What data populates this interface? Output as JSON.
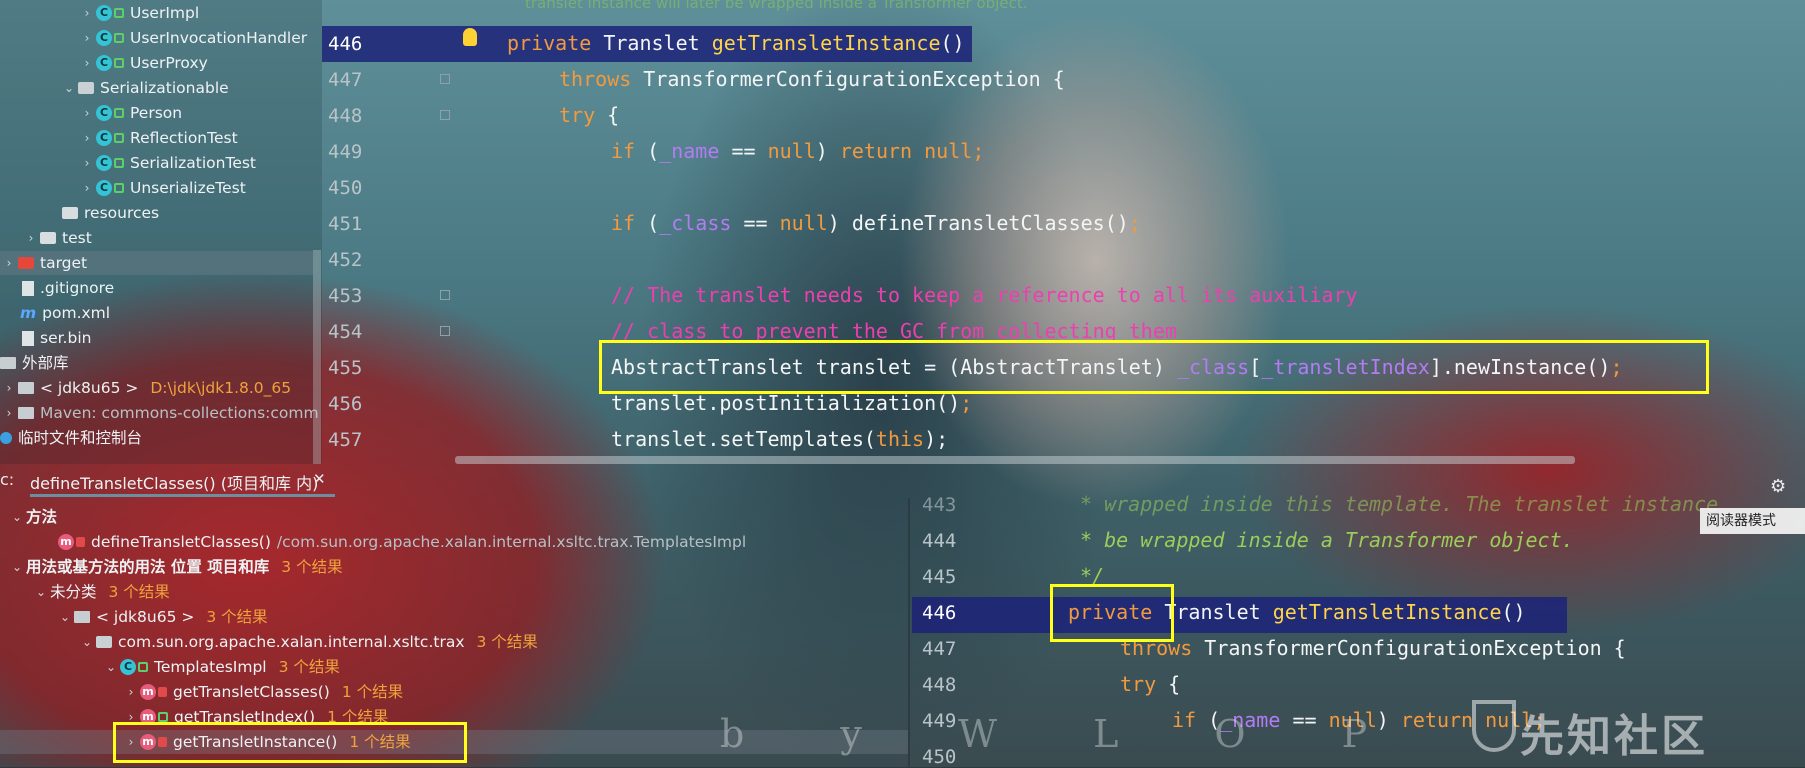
{
  "tree": {
    "items": [
      {
        "label": "UserImpl",
        "icon": "class-icon",
        "indent": 3
      },
      {
        "label": "UserInvocationHandler",
        "icon": "class-icon",
        "indent": 3
      },
      {
        "label": "UserProxy",
        "icon": "class-icon",
        "indent": 3
      },
      {
        "label": "Serializationable",
        "icon": "package-icon",
        "indent": 2
      },
      {
        "label": "Person",
        "icon": "class-icon",
        "indent": 3
      },
      {
        "label": "ReflectionTest",
        "icon": "class-icon",
        "indent": 3
      },
      {
        "label": "SerializationTest",
        "icon": "class-icon",
        "indent": 3
      },
      {
        "label": "UnserializeTest",
        "icon": "class-icon",
        "indent": 3
      },
      {
        "label": "resources",
        "icon": "folder-icon",
        "indent": 1
      },
      {
        "label": "test",
        "icon": "folder-icon",
        "indent": 0
      },
      {
        "label": "target",
        "icon": "folder-red-icon",
        "indent": -1
      },
      {
        "label": ".gitignore",
        "icon": "file-icon",
        "indent": -1
      },
      {
        "label": "pom.xml",
        "icon": "maven-icon",
        "indent": -1
      },
      {
        "label": "ser.bin",
        "icon": "file-icon",
        "indent": -1
      },
      {
        "label": "外部库",
        "icon": "library-icon",
        "indent": -2
      },
      {
        "label": "< jdk8u65 >",
        "extra": "D:\\jdk\\jdk1.8.0_65",
        "icon": "library-icon",
        "indent": -1
      },
      {
        "label": "Maven: commons-collections:comm",
        "icon": "library-icon",
        "indent": -1
      },
      {
        "label": "临时文件和控制台",
        "icon": "console-icon",
        "indent": -2
      }
    ]
  },
  "editor_top": {
    "faded_comment": "translet instance will later be wrapped inside a Transformer object.",
    "line_numbers": [
      "446",
      "447",
      "448",
      "449",
      "450",
      "451",
      "452",
      "453",
      "454",
      "455",
      "456",
      "457"
    ],
    "lines": {
      "l446a": "private",
      "l446b": " Translet ",
      "l446c": "getTransletInstance",
      "l446d": "()",
      "l447a": "throws",
      "l447b": " TransformerConfigurationException {",
      "l448a": "try",
      "l448b": " {",
      "l449a": "if",
      "l449b": " (",
      "l449c": "_name",
      "l449d": " == ",
      "l449e": "null",
      "l449f": ") ",
      "l449g": "return",
      "l449h": " ",
      "l449i": "null",
      "l449j": ";",
      "l451a": "if",
      "l451b": " (",
      "l451c": "_class",
      "l451d": " == ",
      "l451e": "null",
      "l451f": ") defineTransletClasses()",
      "l451g": ";",
      "l453": "// The translet needs to keep a reference to all its auxiliary",
      "l454": "// class to prevent the GC from collecting them",
      "l455a": "AbstractTranslet translet = (AbstractTranslet) ",
      "l455b": "_class",
      "l455c": "[",
      "l455d": "_transletIndex",
      "l455e": "].newInstance()",
      "l455f": ";",
      "l456a": "translet.postInitialization()",
      "l456b": ";",
      "l457a": "translet.setTemplates(",
      "l457b": "this",
      "l457c": ");"
    }
  },
  "find_usages": {
    "tab_prefix": "c:",
    "tab_label": "defineTransletClasses() (项目和库 内)",
    "close_glyph": "✕",
    "rows": [
      {
        "text": "方法",
        "count": ""
      },
      {
        "text": "defineTransletClasses()",
        "count": "/com.sun.org.apache.xalan.internal.xsltc.trax.TemplatesImpl"
      },
      {
        "text": "用法或基方法的用法 位置 项目和库",
        "count": "3 个结果"
      },
      {
        "text": "未分类",
        "count": "3 个结果"
      },
      {
        "text": "< jdk8u65 >",
        "count": "3 个结果"
      },
      {
        "text": "com.sun.org.apache.xalan.internal.xsltc.trax",
        "count": "3 个结果"
      },
      {
        "text": "TemplatesImpl",
        "count": "3 个结果"
      },
      {
        "text": "getTransletClasses()",
        "count": "1 个结果"
      },
      {
        "text": "getTransletIndex()",
        "count": "1 个结果"
      },
      {
        "text": "getTransletInstance()",
        "count": "1 个结果"
      }
    ]
  },
  "preview": {
    "line_numbers": [
      "443",
      "444",
      "445",
      "446",
      "447",
      "448",
      "449",
      "450"
    ],
    "l443": "* wrapped inside this template. The translet instance",
    "l444": "* be wrapped inside a Transformer object.",
    "l445": "*/",
    "l446a": "private",
    "l446b": " Translet ",
    "l446c": "getTransletInstance",
    "l446d": "()",
    "l447a": "throws",
    "l447b": " TransformerConfigurationException {",
    "l448a": "try",
    "l448b": " {",
    "l449a": "if",
    "l449b": " (",
    "l449c": "_name",
    "l449d": " == ",
    "l449e": "null",
    "l449f": ") ",
    "l449g": "return",
    "l449h": " ",
    "l449i": "null",
    "l449j": ";"
  },
  "overlay": {
    "reader_mode": "阅读器模式",
    "watermark": "先知社区",
    "signature": "b y   W L O P",
    "gear": "⚙"
  },
  "colors": {
    "keyword": "#f19a3f",
    "method": "#ffd34a",
    "field": "#b27cf2",
    "comment": "#ee3fb0",
    "highlight_box": "#ffff1a",
    "current_line": "#1c2278"
  }
}
